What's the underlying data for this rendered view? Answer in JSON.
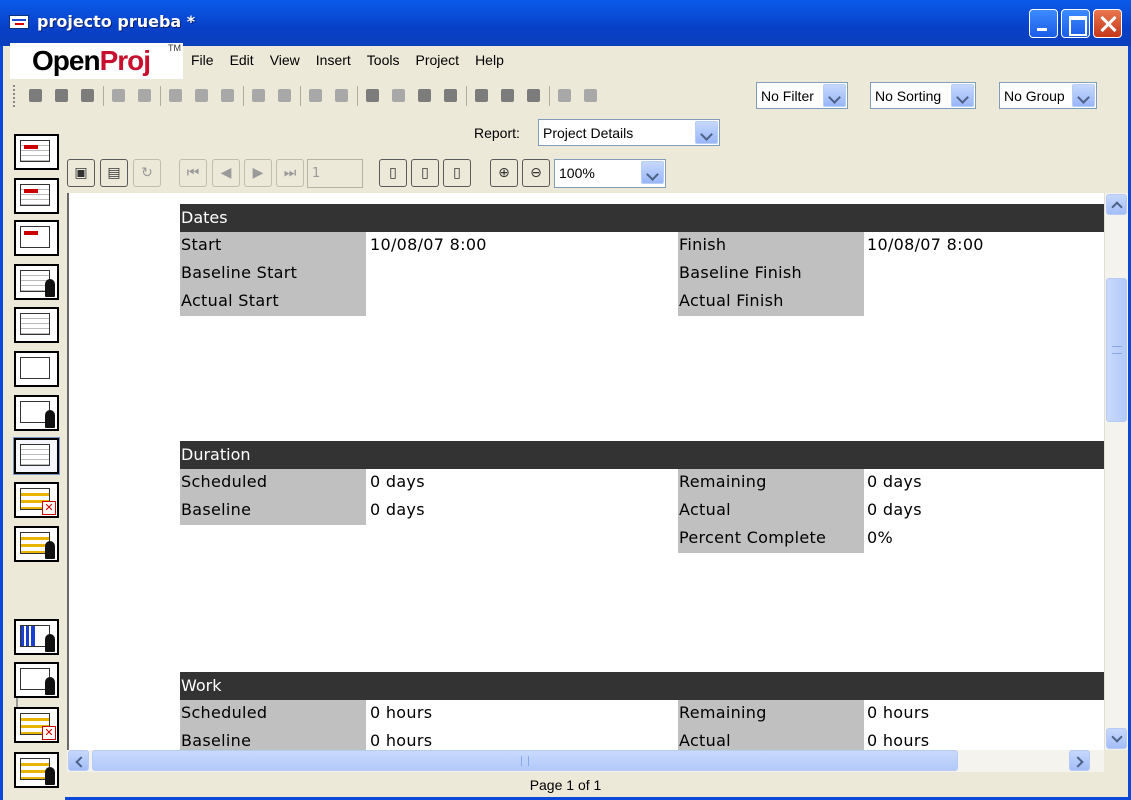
{
  "window": {
    "title": "projecto prueba *"
  },
  "logo": {
    "text_open": "Open",
    "text_proj": "Proj",
    "tm": "TM"
  },
  "menu": [
    "File",
    "Edit",
    "View",
    "Insert",
    "Tools",
    "Project",
    "Help"
  ],
  "toolbar": {
    "filter": "No Filter",
    "sorting": "No Sorting",
    "group": "No Group"
  },
  "report": {
    "label": "Report:",
    "selected": "Project Details"
  },
  "preview": {
    "page_field": "1",
    "zoom": "100%"
  },
  "sections": [
    {
      "title": "Dates",
      "rows": [
        {
          "label1": "Start",
          "value1": "10/08/07 8:00",
          "label2": "Finish",
          "value2": "10/08/07 8:00"
        },
        {
          "label1": "Baseline Start",
          "value1": "",
          "label2": "Baseline Finish",
          "value2": ""
        },
        {
          "label1": "Actual Start",
          "value1": "",
          "label2": "Actual Finish",
          "value2": ""
        }
      ]
    },
    {
      "title": "Duration",
      "rows": [
        {
          "label1": "Scheduled",
          "value1": "0 days",
          "label2": "Remaining",
          "value2": "0 days"
        },
        {
          "label1": "Baseline",
          "value1": "0 days",
          "label2": "Actual",
          "value2": "0 days"
        },
        {
          "label1": "",
          "value1": "",
          "label2": "Percent Complete",
          "value2": "0%"
        }
      ]
    },
    {
      "title": "Work",
      "rows": [
        {
          "label1": "Scheduled",
          "value1": "0 hours",
          "label2": "Remaining",
          "value2": "0 hours"
        },
        {
          "label1": "Baseline",
          "value1": "0 hours",
          "label2": "Actual",
          "value2": "0 hours"
        }
      ]
    }
  ],
  "status": {
    "page": "Page 1 of 1"
  }
}
